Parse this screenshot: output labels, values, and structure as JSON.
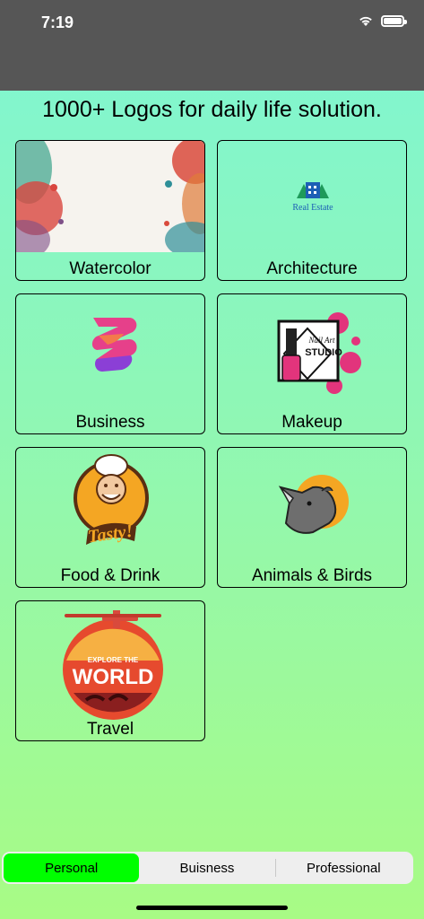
{
  "status": {
    "time": "7:19"
  },
  "heading": "1000+ Logos for daily life solution.",
  "cards": [
    {
      "label": "Watercolor"
    },
    {
      "label": "Architecture",
      "logo_text": "Real Estate"
    },
    {
      "label": "Business"
    },
    {
      "label": "Makeup",
      "logo_text_1": "Nail Art",
      "logo_text_2": "STUDIO"
    },
    {
      "label": "Food & Drink",
      "logo_text": "Tasty!"
    },
    {
      "label": "Animals & Birds"
    },
    {
      "label": "Travel",
      "logo_text_1": "EXPLORE THE",
      "logo_text_2": "WORLD"
    }
  ],
  "tabs": [
    {
      "label": "Personal",
      "active": true
    },
    {
      "label": "Buisness",
      "active": false
    },
    {
      "label": "Professional",
      "active": false
    }
  ],
  "colors": {
    "active_tab": "#00ff00",
    "statusbar": "#565656"
  }
}
